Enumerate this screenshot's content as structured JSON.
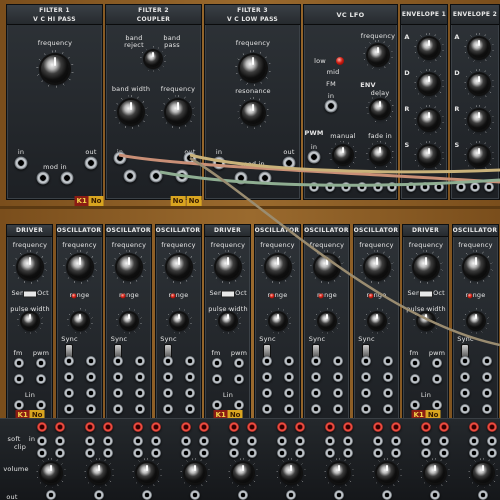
{
  "top_modules": [
    {
      "title_line1": "FILTER 1",
      "title_line2": "V C HI PASS",
      "knob_label": "frequency",
      "in": "in",
      "mod_in": "mod in",
      "out": "out",
      "badge_k": "K1",
      "badge_n": "No"
    },
    {
      "title_line1": "FILTER 2",
      "title_line2": "COUPLER",
      "band_reject": "band reject",
      "band_pass": "band pass",
      "band_width": "band width",
      "frequency": "frequency",
      "in": "in",
      "out": "out",
      "badge_n1": "No",
      "badge_n2": "No"
    },
    {
      "title_line1": "FILTER 3",
      "title_line2": "V C LOW PASS",
      "frequency": "frequency",
      "resonance": "resonance",
      "in": "in",
      "mod_in": "mod in",
      "out": "out"
    },
    {
      "title": "VC LFO",
      "low": "low",
      "mid": "mid",
      "frequency": "frequency",
      "fm": "FM",
      "in": "in",
      "env": "ENV",
      "delay": "delay",
      "pwm": "PWM",
      "manual": "manual",
      "fade_in": "fade in",
      "in2": "in"
    },
    {
      "title": "ENVELOPE 1",
      "letters": [
        "A",
        "D",
        "R",
        "S"
      ]
    },
    {
      "title": "ENVELOPE 2",
      "letters": [
        "A",
        "D",
        "R",
        "S"
      ]
    }
  ],
  "osc_modules": [
    {
      "title": "DRIVER",
      "frequency": "frequency",
      "semi": "Sem",
      "oct": "Oct",
      "pulse_width": "pulse width",
      "fm": "fm",
      "pwm": "pwm",
      "lin": "Lin",
      "badge_k": "K1",
      "badge_n": "No"
    },
    {
      "title": "OSCILLATOR",
      "frequency": "frequency",
      "range": "range",
      "sync": "Sync"
    },
    {
      "title": "OSCILLATOR",
      "frequency": "frequency",
      "range": "range",
      "sync": "Sync"
    },
    {
      "title": "OSCILLATOR",
      "frequency": "frequency",
      "range": "range",
      "sync": "Sync"
    },
    {
      "title": "DRIVER",
      "frequency": "frequency",
      "semi": "Sem",
      "oct": "Oct",
      "pulse_width": "pulse width",
      "fm": "fm",
      "pwm": "pwm",
      "lin": "Lin",
      "badge_k": "K1",
      "badge_n": "No"
    },
    {
      "title": "OSCILLATOR",
      "frequency": "frequency",
      "range": "range",
      "sync": "Sync"
    },
    {
      "title": "OSCILLATOR",
      "frequency": "frequency",
      "range": "range",
      "sync": "Sync"
    },
    {
      "title": "OSCILLATOR",
      "frequency": "frequency",
      "range": "range",
      "sync": "Sync"
    },
    {
      "title": "DRIVER",
      "frequency": "frequency",
      "semi": "Sem",
      "oct": "Oct",
      "pulse_width": "pulse width",
      "fm": "fm",
      "pwm": "pwm",
      "lin": "Lin",
      "badge_k": "K1",
      "badge_n": "No"
    },
    {
      "title": "OSCILLATOR",
      "frequency": "frequency",
      "range": "range",
      "sync": "Sync"
    }
  ],
  "mixer": {
    "soft": "soft",
    "in": "in",
    "clip": "clip",
    "volume": "volume",
    "out": "out"
  },
  "cable_colors": [
    "#c98f76",
    "#8fae92",
    "#c9b27a",
    "#9a8c70"
  ]
}
